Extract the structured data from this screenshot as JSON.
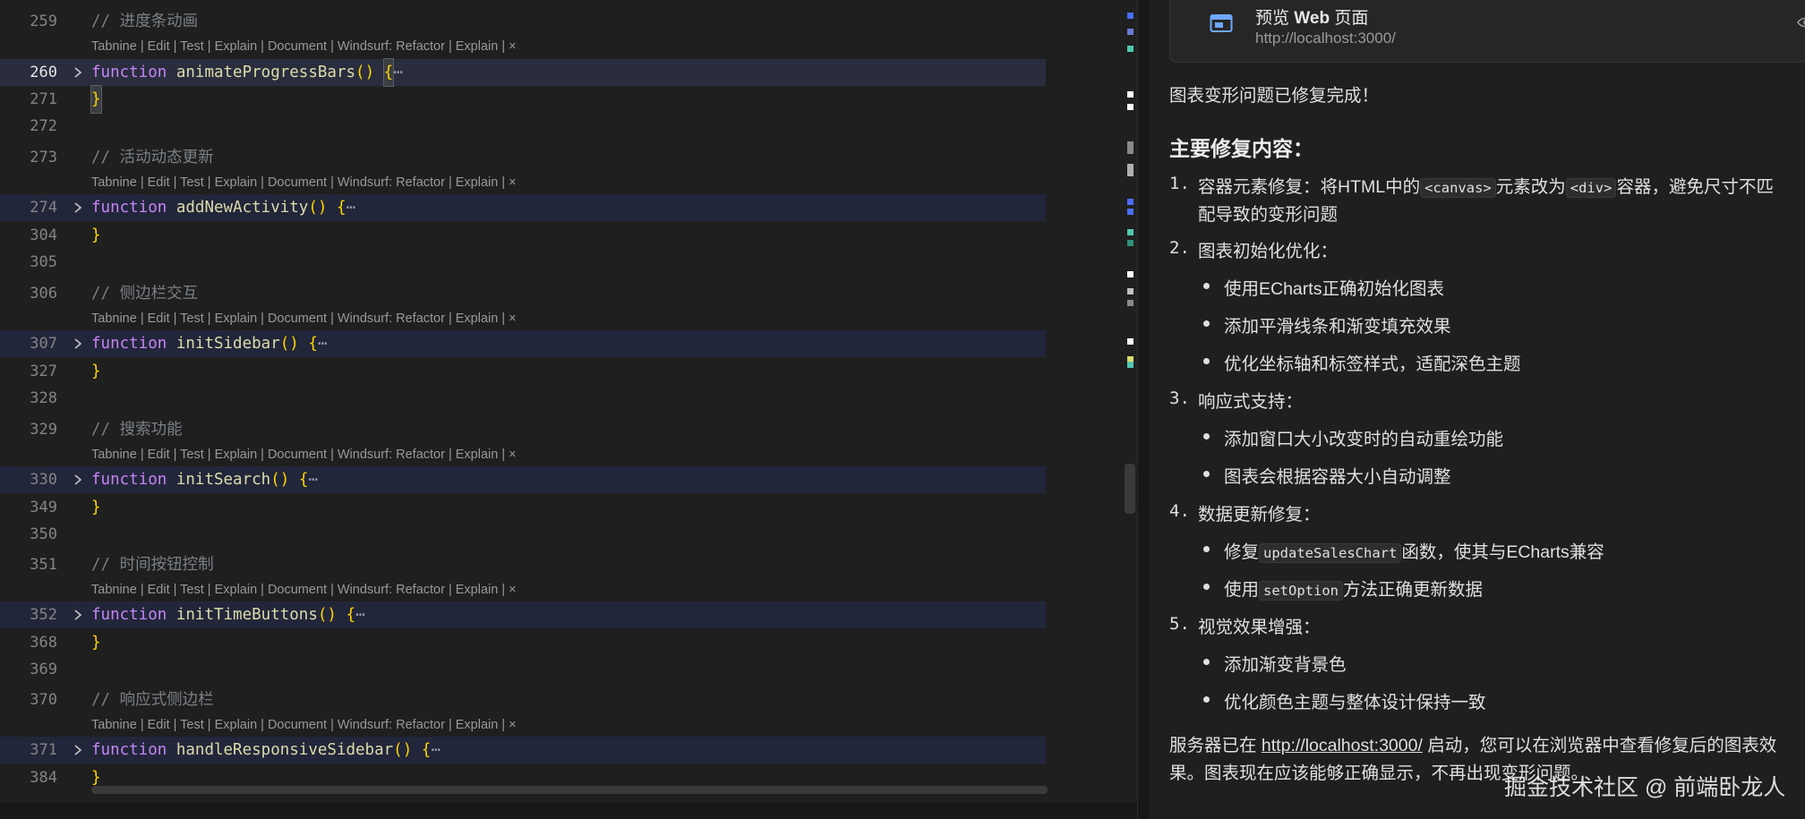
{
  "editor": {
    "lens_text": "Tabnine | Edit | Test | Explain | Document | Windsurf: Refactor | Explain | ",
    "lens_close": "×",
    "ellipsis": "⋯",
    "lines": [
      {
        "n": "259",
        "comment": "// 进度条动画"
      },
      {
        "n": "260",
        "fn": "animateProgressBars",
        "active": true
      },
      {
        "n": "271",
        "close": "}"
      },
      {
        "n": "272"
      },
      {
        "n": "273",
        "comment": "// 活动动态更新"
      },
      {
        "n": "274",
        "fn": "addNewActivity"
      },
      {
        "n": "304",
        "close": "}"
      },
      {
        "n": "305"
      },
      {
        "n": "306",
        "comment": "// 侧边栏交互"
      },
      {
        "n": "307",
        "fn": "initSidebar"
      },
      {
        "n": "327",
        "close": "}"
      },
      {
        "n": "328"
      },
      {
        "n": "329",
        "comment": "// 搜索功能"
      },
      {
        "n": "330",
        "fn": "initSearch"
      },
      {
        "n": "349",
        "close": "}"
      },
      {
        "n": "350"
      },
      {
        "n": "351",
        "comment": "// 时间按钮控制"
      },
      {
        "n": "352",
        "fn": "initTimeButtons"
      },
      {
        "n": "368",
        "close": "}"
      },
      {
        "n": "369"
      },
      {
        "n": "370",
        "comment": "// 响应式侧边栏"
      },
      {
        "n": "371",
        "fn": "handleResponsiveSidebar"
      },
      {
        "n": "384",
        "close": "}"
      }
    ],
    "keyword": "function",
    "parens": "()",
    "open_brace": "{"
  },
  "panel": {
    "preview_card": {
      "title_prefix": "预览 ",
      "title_bold": "Web",
      "title_suffix": " 页面",
      "url": "http://localhost:3000/",
      "icon": "browser-window-icon",
      "action_icon": "eye-icon"
    },
    "intro": "图表变形问题已修复完成！",
    "heading": "主要修复内容：",
    "items": [
      {
        "num": "1.",
        "a": "容器元素修复：将HTML中的",
        "code1": "<canvas>",
        "b": "元素改为",
        "code2": "<div>",
        "c": "容器，避免尺寸不匹",
        "d": "配导致的变形问题"
      },
      {
        "num": "2.",
        "text": "图表初始化优化：",
        "subs": [
          "使用ECharts正确初始化图表",
          "添加平滑线条和渐变填充效果",
          "优化坐标轴和标签样式，适配深色主题"
        ]
      },
      {
        "num": "3.",
        "text": "响应式支持：",
        "subs": [
          "添加窗口大小改变时的自动重绘功能",
          "图表会根据容器大小自动调整"
        ]
      },
      {
        "num": "4.",
        "text": "数据更新修复：",
        "sub1_a": "修复",
        "sub1_code": "updateSalesChart",
        "sub1_b": "函数，使其与ECharts兼容",
        "sub2_a": "使用",
        "sub2_code": "setOption",
        "sub2_b": "方法正确更新数据"
      },
      {
        "num": "5.",
        "text": "视觉效果增强：",
        "subs": [
          "添加渐变背景色",
          "优化颜色主题与整体设计保持一致"
        ]
      }
    ],
    "footer_a": "服务器已在 ",
    "footer_link": "http://localhost:3000/",
    "footer_b": " 启动，您可以在浏览器中查看修复后的图表效",
    "footer_c": "果。图表现在应该能够正确显示，不再出现变形问题。"
  },
  "watermark": "掘金技术社区 @ 前端卧龙人"
}
